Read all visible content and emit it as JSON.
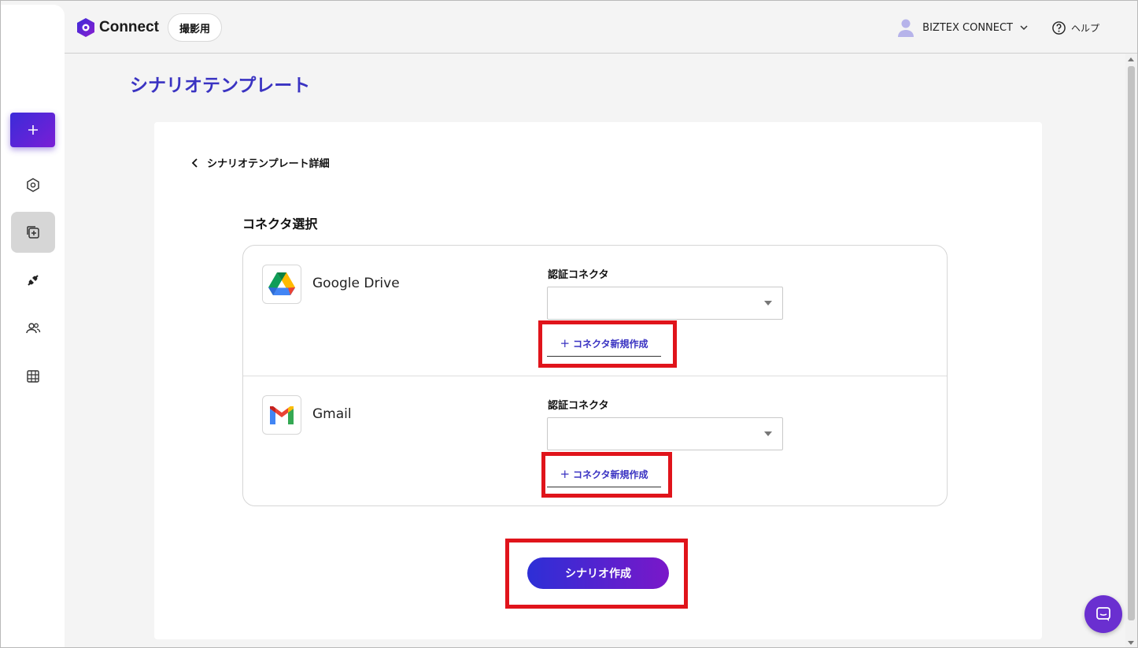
{
  "app": {
    "name": "Connect",
    "environment": "撮影用"
  },
  "header": {
    "account": "BIZTEX CONNECT",
    "help": "ヘルプ"
  },
  "page": {
    "title": "シナリオテンプレート",
    "back_label": "シナリオテンプレート詳細",
    "section_title": "コネクタ選択"
  },
  "connectors": [
    {
      "service": "Google Drive",
      "icon": "google-drive-icon",
      "auth_label": "認証コネクタ",
      "auth_value": "",
      "new_connector": "コネクタ新規作成"
    },
    {
      "service": "Gmail",
      "icon": "gmail-icon",
      "auth_label": "認証コネクタ",
      "auth_value": "",
      "new_connector": "コネクタ新規作成"
    }
  ],
  "actions": {
    "create_scenario": "シナリオ作成"
  },
  "sidebar": {
    "items": [
      {
        "icon": "add-icon"
      },
      {
        "icon": "connect-logo-icon"
      },
      {
        "icon": "template-icon",
        "active": true
      },
      {
        "icon": "plug-icon"
      },
      {
        "icon": "users-icon"
      },
      {
        "icon": "table-icon"
      }
    ]
  },
  "colors": {
    "accent": "#3a33c2",
    "gradient_start": "#2d2fd6",
    "gradient_end": "#7a17c9",
    "highlight": "#e0141b"
  }
}
